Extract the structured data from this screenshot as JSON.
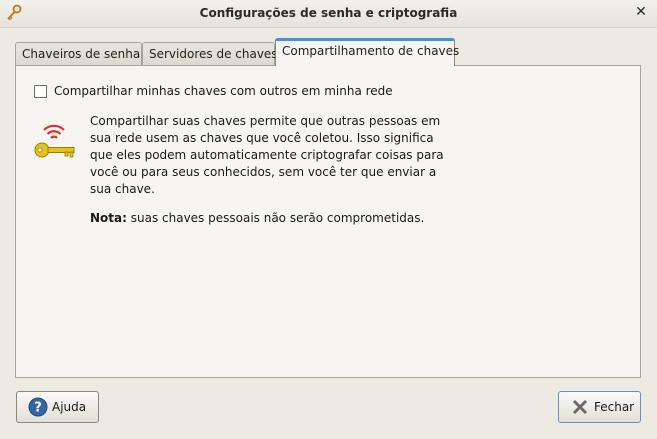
{
  "window": {
    "title": "Configurações de senha e criptografia",
    "app_icon": "keys-icon",
    "close_icon": "close-icon",
    "close_glyph": "✕"
  },
  "tabs": [
    {
      "label": "Chaveiros de senha",
      "active": false
    },
    {
      "label": "Servidores de chaves",
      "active": false
    },
    {
      "label": "Compartilhamento de chaves",
      "active": true
    }
  ],
  "sharing": {
    "checkbox_label": "Compartilhar minhas chaves com outros em minha rede",
    "checkbox_checked": false,
    "icon": "key-broadcast-icon",
    "description": "Compartilhar suas chaves permite que outras pessoas em sua rede usem as chaves que você coletou. Isso significa que eles podem automaticamente criptografar coisas para você ou para seus conhecidos, sem você ter que enviar a sua chave.",
    "note_label": "Nota:",
    "note_text": " suas chaves pessoais não serão comprometidas."
  },
  "buttons": {
    "help_label": "Ajuda",
    "help_icon": "help-icon",
    "close_label": "Fechar",
    "close_icon": "close-x-icon"
  },
  "colors": {
    "accent": "#4a90d9",
    "key_gold": "#e8c21c",
    "signal_red": "#d9332b"
  }
}
